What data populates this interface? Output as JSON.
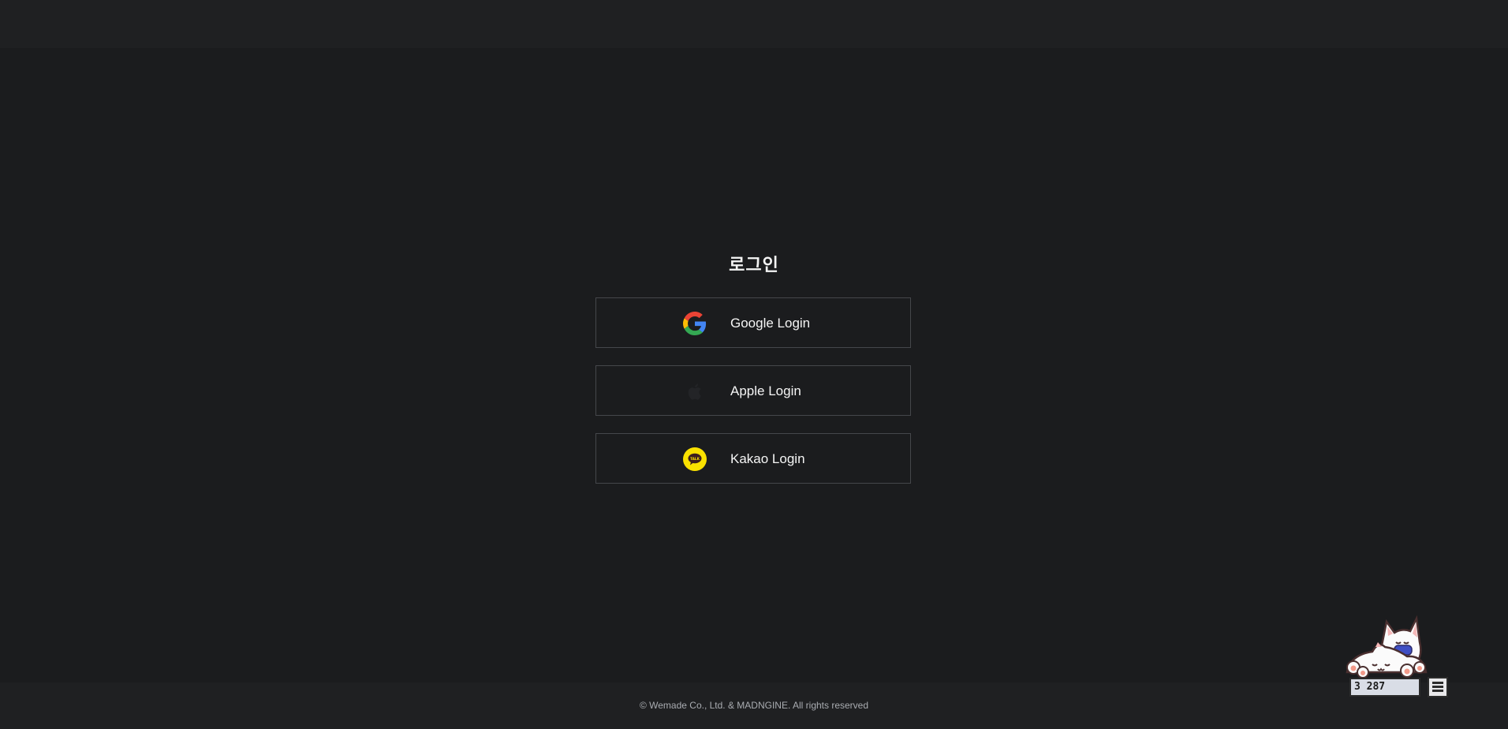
{
  "login": {
    "title": "로그인",
    "buttons": [
      {
        "label": "Google Login",
        "icon": "google-icon"
      },
      {
        "label": "Apple Login",
        "icon": "apple-icon"
      },
      {
        "label": "Kakao Login",
        "icon": "kakao-talk-icon"
      }
    ]
  },
  "footer": {
    "copyright": "© Wemade Co., Ltd. & MADNGINE. All rights reserved"
  },
  "widget": {
    "counter": "3 287",
    "menu_icon": "hamburger-menu-icon",
    "mascot_icon": "cat-mascot-icon"
  },
  "colors": {
    "background": "#1b1c1e",
    "header_footer": "#1f2022",
    "button_border": "#45474b",
    "kakao_yellow": "#fae100"
  }
}
